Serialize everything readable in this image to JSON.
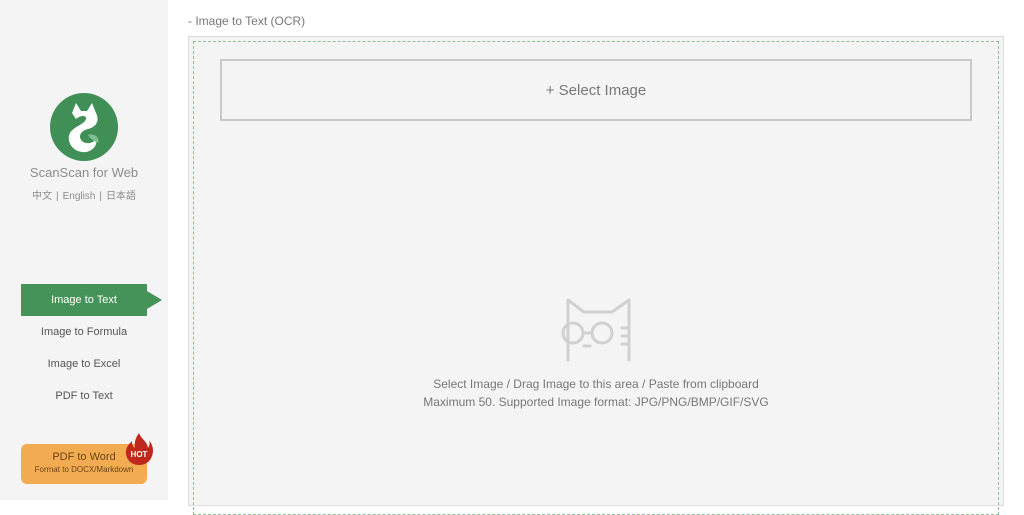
{
  "sidebar": {
    "app_name": "ScanScan for Web",
    "languages": [
      "中文",
      "English",
      "日本語"
    ],
    "nav_items": [
      {
        "label": "Image to Text",
        "active": true
      },
      {
        "label": "Image to Formula",
        "active": false
      },
      {
        "label": "Image to Excel",
        "active": false
      },
      {
        "label": "PDF to Text",
        "active": false
      }
    ],
    "promo": {
      "title": "PDF to Word",
      "subtitle": "Format to DOCX/Markdown",
      "badge": "HOT"
    }
  },
  "main": {
    "title": "- Image to Text (OCR)",
    "select_button": "+ Select Image",
    "hint_line1": "Select Image / Drag Image to this area / Paste from clipboard",
    "hint_line2": "Maximum 50. Supported Image format: JPG/PNG/BMP/GIF/SVG"
  },
  "icons": {
    "logo": "cat-logo-icon",
    "empty_state": "cat-glasses-icon",
    "hot_badge": "fire-icon"
  },
  "colors": {
    "brand_green": "#46935a",
    "promo_orange": "#f3ab52",
    "hot_red": "#c0281e"
  }
}
